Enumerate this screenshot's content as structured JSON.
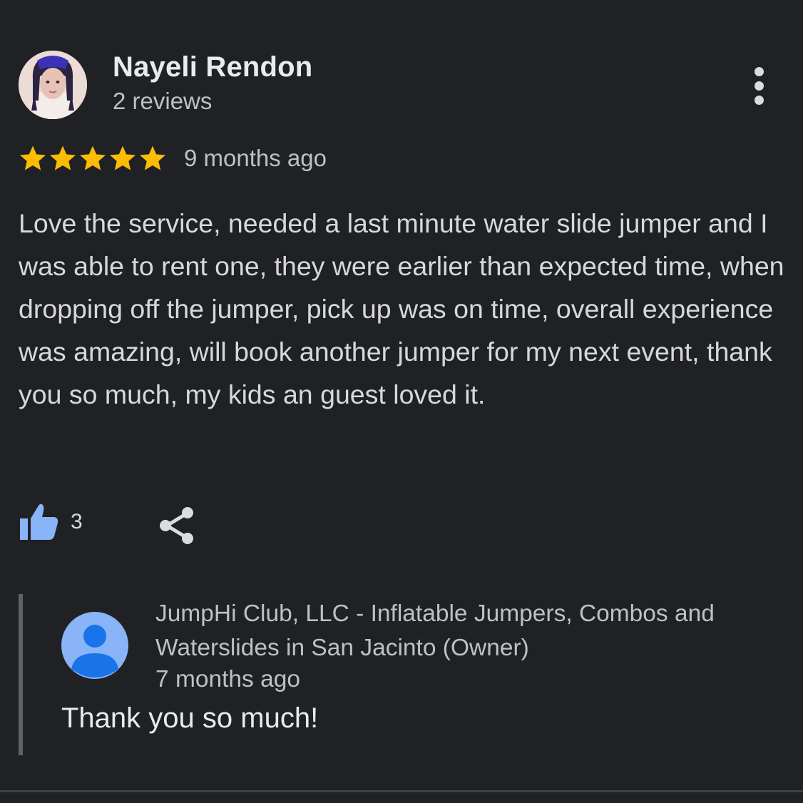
{
  "reviewer": {
    "name": "Nayeli Rendon",
    "meta": "2 reviews",
    "avatar_icon": "user-photo-icon"
  },
  "rating": {
    "stars": 5,
    "max_stars": 5,
    "star_color": "#fbbc04",
    "time": "9 months ago"
  },
  "review": {
    "text": "Love the service, needed a last minute water slide jumper and I was able to rent one, they were earlier than expected time, when dropping off the jumper, pick up was on time, overall experience was amazing, will book another jumper for my next event, thank you so much, my kids an guest loved it."
  },
  "actions": {
    "like_icon": "thumbs-up-icon",
    "like_count": "3",
    "like_color": "#8ab4f8",
    "share_icon": "share-icon",
    "more_icon": "more-vert-icon"
  },
  "owner_response": {
    "name": "JumpHi Club, LLC - Inflatable Jumpers, Combos and Waterslides in San Jacinto (Owner)",
    "time": "7 months ago",
    "text": "Thank you so much!",
    "avatar_icon": "person-icon",
    "avatar_color": "#8ab4f8"
  }
}
